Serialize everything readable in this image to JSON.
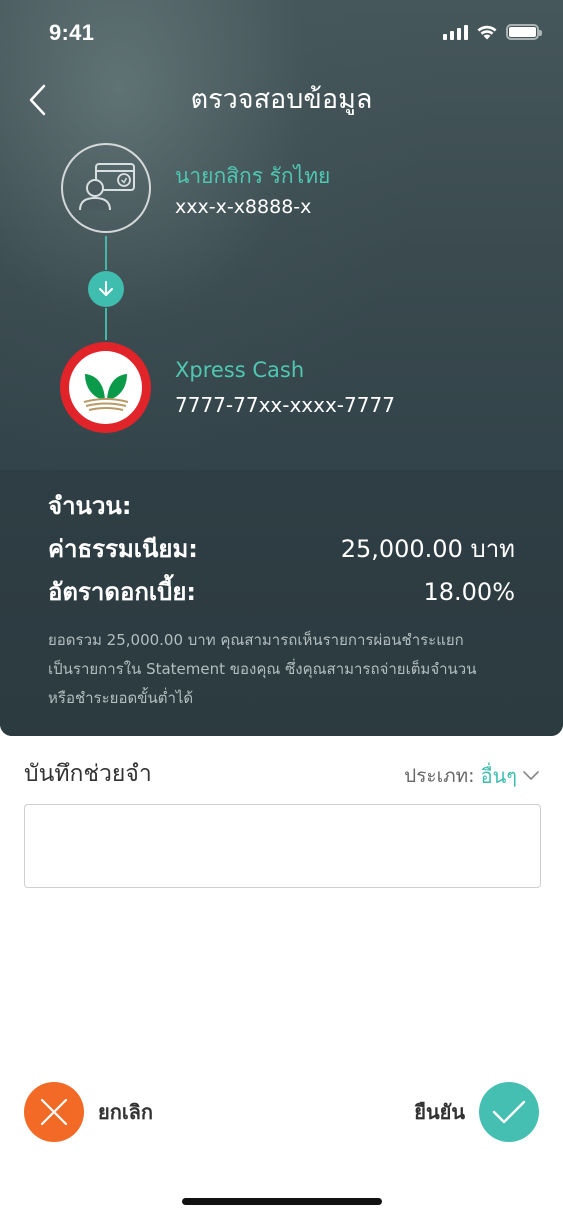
{
  "status_bar": {
    "time": "9:41"
  },
  "header": {
    "title": "ตรวจสอบข้อมูล"
  },
  "transfer": {
    "from": {
      "name": "นายกสิกร รักไทย",
      "account": "xxx-x-x8888-x"
    },
    "to": {
      "name": "Xpress Cash",
      "account": "7777-77xx-xxxx-7777"
    }
  },
  "details": {
    "amount_label": "จำนวน:",
    "amount_value": "",
    "fee_label": "ค่าธรรมเนียม:",
    "fee_value": "25,000.00 บาท",
    "rate_label": "อัตราดอกเบี้ย:",
    "rate_value": "18.00%",
    "note_line1": "ยอดรวม 25,000.00 บาท คุณสามารถเห็นรายการผ่อนชำระแยก",
    "note_line2": "เป็นรายการใน Statement ของคุณ ซึ่งคุณสามารถจ่ายเต็มจำนวน",
    "note_line3": "หรือชำระยอดขั้นต่ำได้"
  },
  "memo": {
    "label": "บันทึกช่วยจำ",
    "type_label": "ประเภท:",
    "type_value": "อื่นๆ",
    "input_value": ""
  },
  "actions": {
    "cancel_label": "ยกเลิก",
    "confirm_label": "ยืนยัน"
  },
  "colors": {
    "accent": "#3fbeb0",
    "cancel": "#f26a26",
    "bank_red": "#e0242a",
    "bank_green": "#0a9a4a"
  }
}
